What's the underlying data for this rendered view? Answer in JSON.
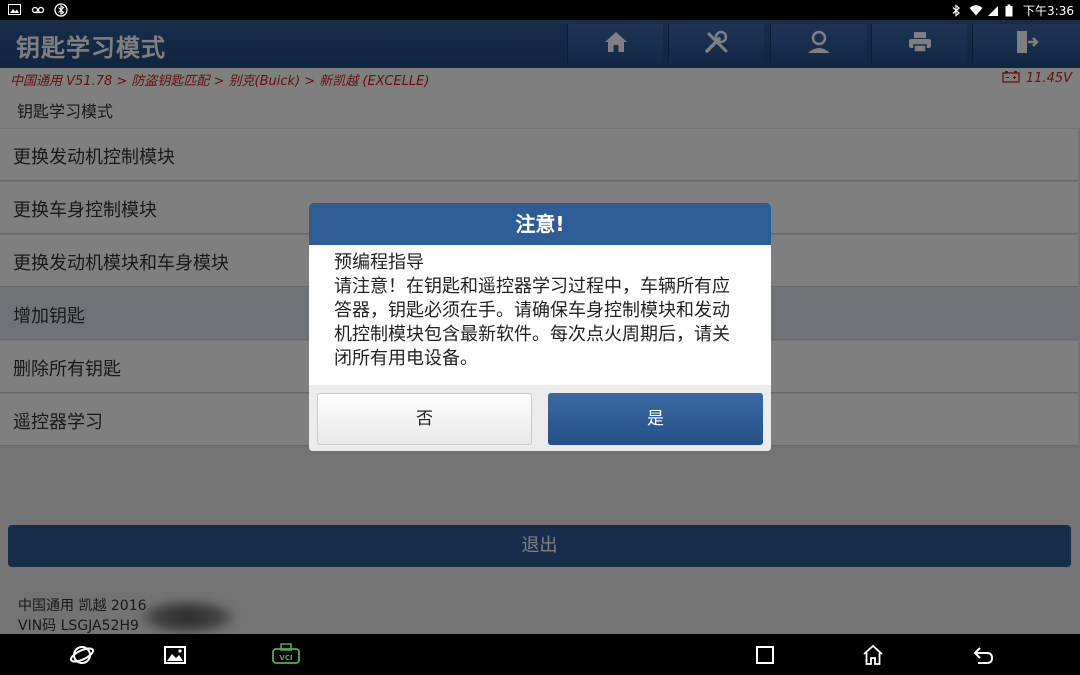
{
  "status_bar": {
    "time": "下午3:36",
    "left_icons": [
      "image-icon",
      "voicemail-icon",
      "bluetooth-circle-icon"
    ],
    "right_icons": [
      "bluetooth-icon",
      "wifi-icon",
      "signal-icon",
      "battery-icon"
    ]
  },
  "header": {
    "title": "钥匙学习模式",
    "toolbar": [
      "home-icon",
      "diagnostic-tools-icon",
      "user-icon",
      "print-icon",
      "exit-icon"
    ]
  },
  "breadcrumb": {
    "path": "中国通用 V51.78 > 防盗钥匙匹配 > 别克(Buick) > 新凯越 (EXCELLE)",
    "voltage": "11.45V"
  },
  "menu": {
    "section_title": "钥匙学习模式",
    "items": [
      {
        "label": "更换发动机控制模块"
      },
      {
        "label": "更换车身控制模块"
      },
      {
        "label": "更换发动机模块和车身模块"
      },
      {
        "label": "增加钥匙",
        "selected": true
      },
      {
        "label": "删除所有钥匙"
      },
      {
        "label": "遥控器学习"
      }
    ],
    "exit_label": "退出"
  },
  "footer": {
    "vehicle": "中国通用 凯越 2016",
    "vin": "VIN码 LSGJA52H9"
  },
  "dialog": {
    "title": "注意!",
    "subtitle": "预编程指导",
    "message": "请注意！在钥匙和遥控器学习过程中，车辆所有应答器，钥匙必须在手。请确保车身控制模块和发动机控制模块包含最新软件。每次点火周期后，请关闭所有用电设备。",
    "no_label": "否",
    "yes_label": "是"
  },
  "nav_bar": {
    "icons": [
      "browser-icon",
      "gallery-icon",
      "vci-icon",
      "recent-apps-icon",
      "home-icon",
      "back-icon"
    ]
  }
}
